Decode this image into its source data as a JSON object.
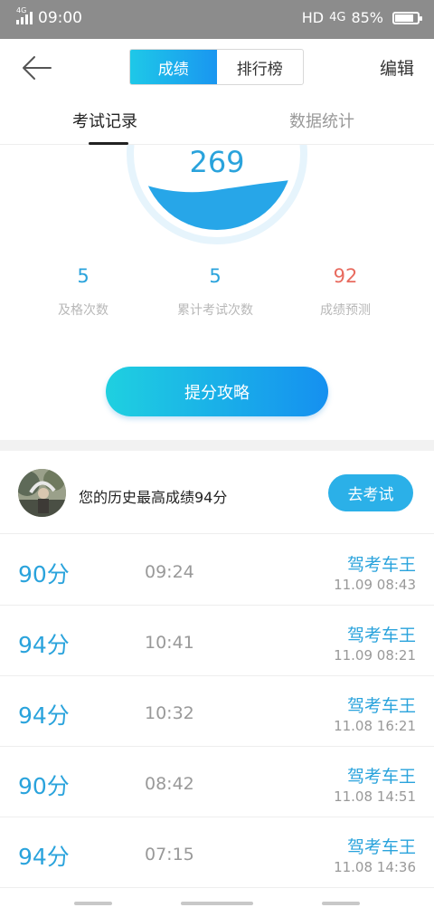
{
  "status_bar": {
    "network": "4G",
    "time": "09:00",
    "hd": "HD",
    "network_right": "4G",
    "battery_percent": "85%",
    "battery_level": 0.85
  },
  "header": {
    "back_icon": "arrow-left-icon",
    "tabs": [
      {
        "label": "成绩",
        "active": true
      },
      {
        "label": "排行榜",
        "active": false
      }
    ],
    "edit_label": "编辑",
    "accent_color": "#1a9ff0"
  },
  "subtabs": [
    {
      "label": "考试记录",
      "active": true
    },
    {
      "label": "数据统计",
      "active": false
    }
  ],
  "gauge": {
    "value": "269"
  },
  "stats": [
    {
      "value": "5",
      "label": "及格次数"
    },
    {
      "value": "5",
      "label": "累计考试次数"
    },
    {
      "value": "92",
      "label": "成绩预测"
    }
  ],
  "tips_button": "提分攻略",
  "best": {
    "text": "您的历史最高成绩94分",
    "button": "去考试"
  },
  "records": [
    {
      "score": "90分",
      "duration": "09:24",
      "title": "驾考车王",
      "date": "11.09  08:43"
    },
    {
      "score": "94分",
      "duration": "10:41",
      "title": "驾考车王",
      "date": "11.09  08:21"
    },
    {
      "score": "94分",
      "duration": "10:32",
      "title": "驾考车王",
      "date": "11.08  16:21"
    },
    {
      "score": "90分",
      "duration": "08:42",
      "title": "驾考车王",
      "date": "11.08  14:51"
    },
    {
      "score": "94分",
      "duration": "07:15",
      "title": "驾考车王",
      "date": "11.08  14:36"
    }
  ]
}
